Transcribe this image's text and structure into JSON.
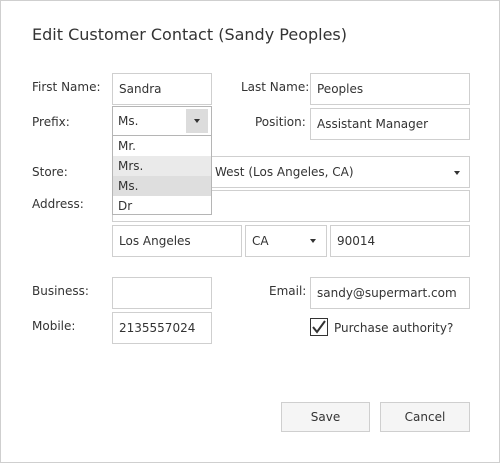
{
  "dialog": {
    "title": "Edit Customer Contact (Sandy Peoples)"
  },
  "labels": {
    "first_name": "First Name:",
    "last_name": "Last Name:",
    "prefix": "Prefix:",
    "position": "Position:",
    "store": "Store:",
    "address": "Address:",
    "business": "Business:",
    "email": "Email:",
    "mobile": "Mobile:",
    "purchase_authority": "Purchase authority?"
  },
  "fields": {
    "first_name": "Sandra",
    "last_name": "Peoples",
    "prefix": "Ms.",
    "position": "Assistant Manager",
    "store": "West (Los Angeles, CA)",
    "address": "",
    "city": "Los Angeles",
    "state": "CA",
    "zip": "90014",
    "business": "",
    "email": "sandy@supermart.com",
    "mobile": "2135557024",
    "purchase_authority": true
  },
  "prefix_dropdown": {
    "options": [
      "Mr.",
      "Mrs.",
      "Ms.",
      "Dr"
    ],
    "hovered": "Mrs.",
    "selected": "Ms."
  },
  "buttons": {
    "save": "Save",
    "cancel": "Cancel"
  },
  "icons": {
    "dropdown_arrow": "chevron-down-icon",
    "check": "checkmark-icon"
  }
}
